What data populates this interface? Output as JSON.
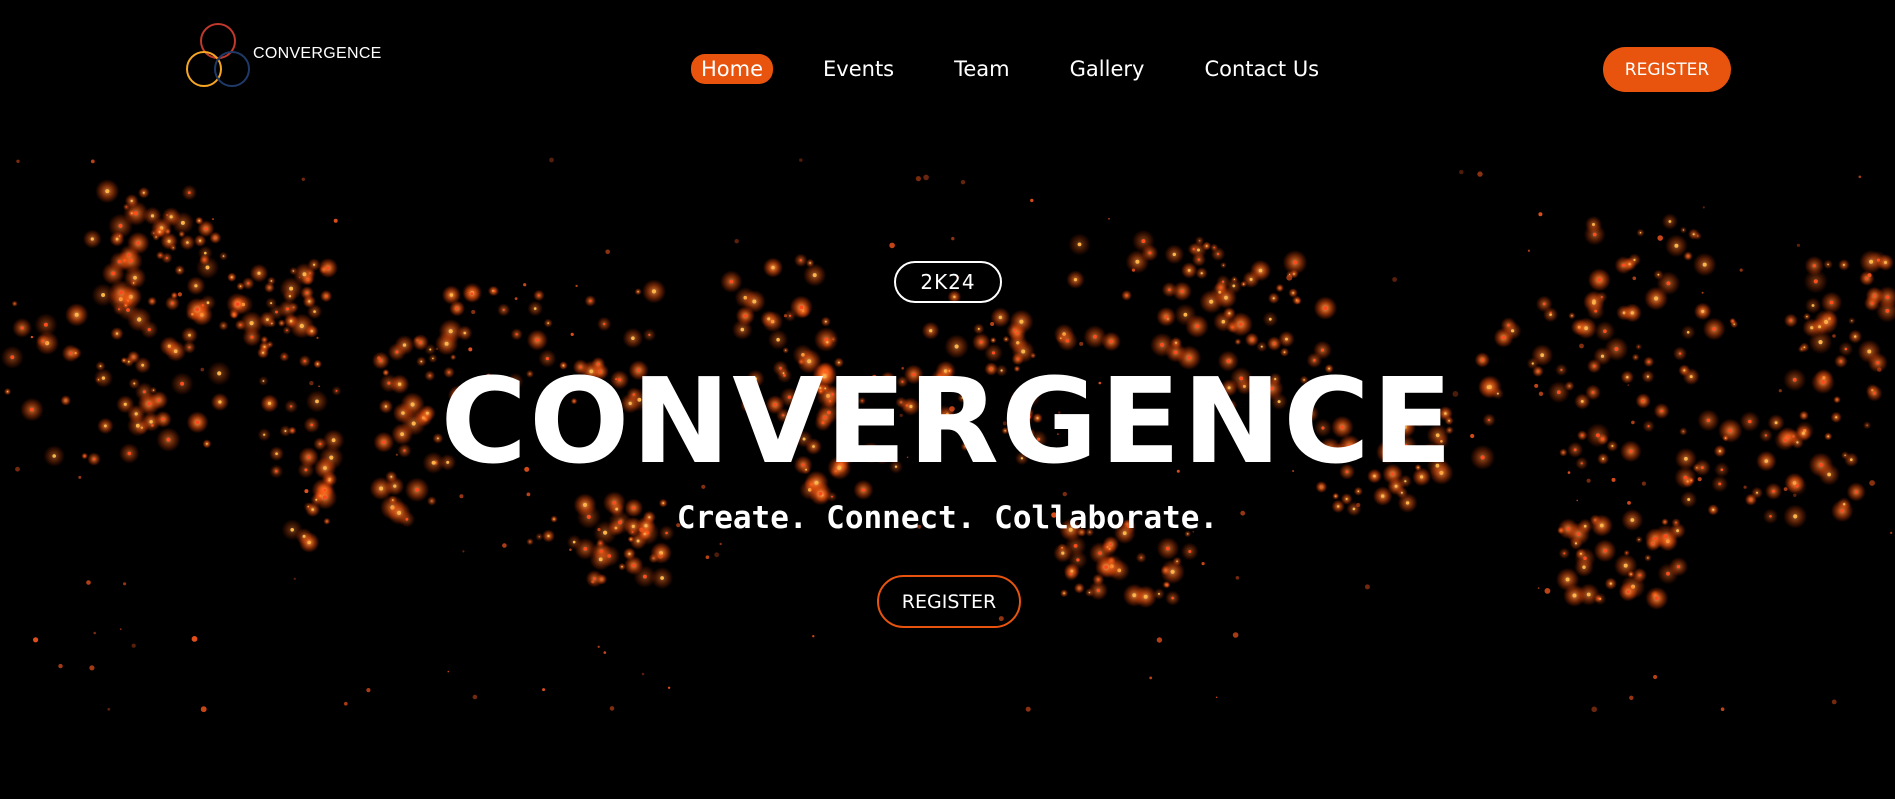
{
  "nav": {
    "logo_text": "CONVERGENCE",
    "links": [
      {
        "label": "Home",
        "active": true
      },
      {
        "label": "Events",
        "active": false
      },
      {
        "label": "Team",
        "active": false
      },
      {
        "label": "Gallery",
        "active": false
      },
      {
        "label": "Contact Us",
        "active": false
      }
    ],
    "register_label": "REGISTER"
  },
  "hero": {
    "badge": "2K24",
    "title": "CONVERGENCE",
    "tagline": "Create. Connect. Collaborate.",
    "register_label": "REGISTER"
  },
  "colors": {
    "accent": "#e8540e",
    "background": "#000000",
    "logo_ring_red": "#c0392b",
    "logo_ring_yellow": "#f5a623",
    "logo_ring_blue": "#1f3a68"
  },
  "icons": {
    "logo": "three-overlapping-rings-icon"
  }
}
